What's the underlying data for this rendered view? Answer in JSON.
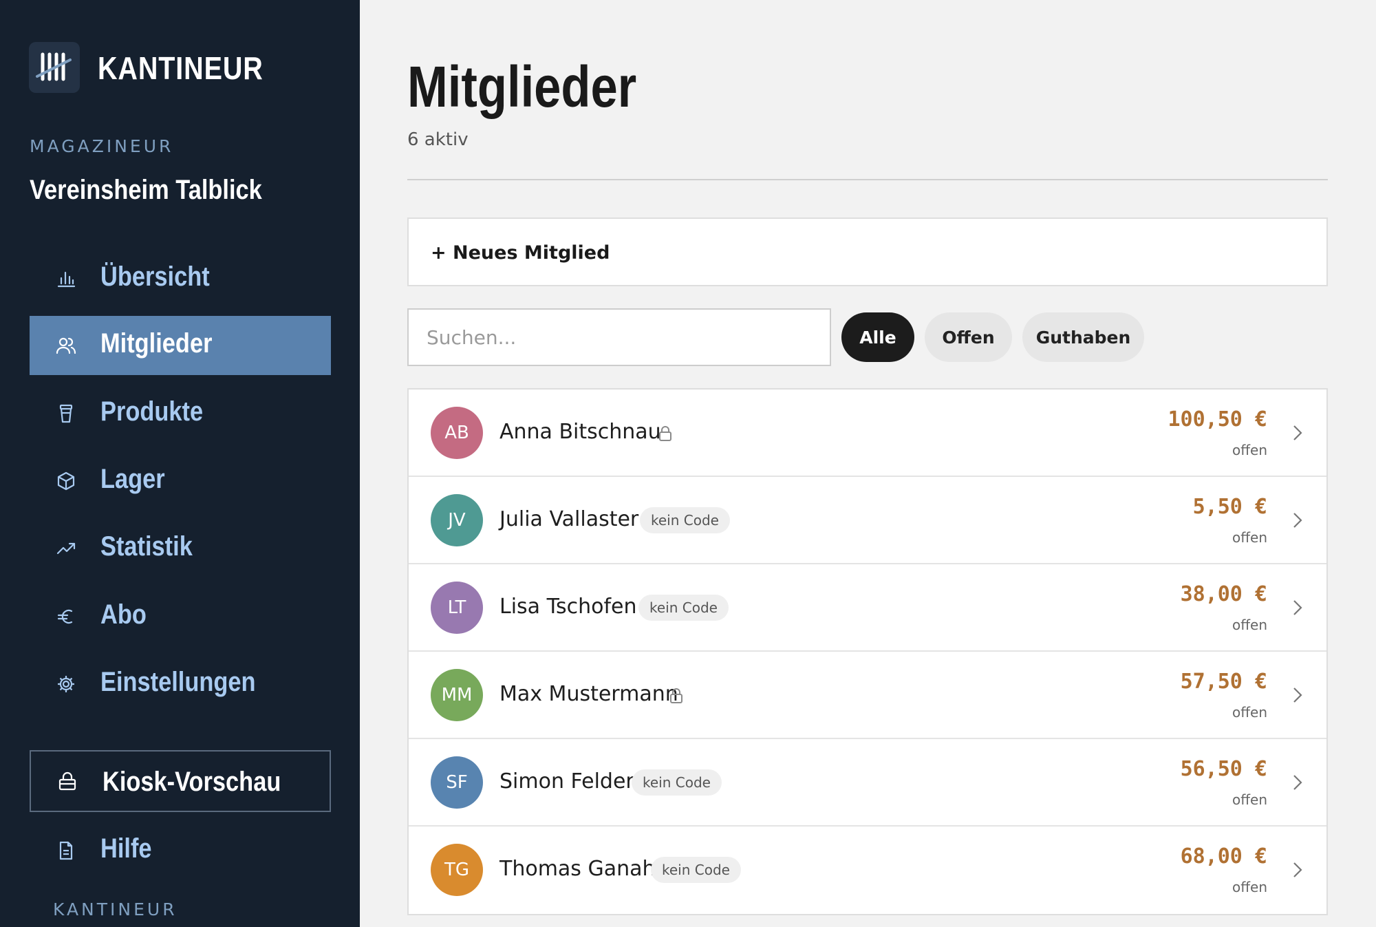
{
  "sidebar": {
    "brand": "KANTINEUR",
    "role_label": "MAGAZINEUR",
    "venue": "Vereinsheim Talblick",
    "nav": [
      {
        "label": "Übersicht",
        "icon": "bar-chart-icon"
      },
      {
        "label": "Mitglieder",
        "icon": "users-icon"
      },
      {
        "label": "Produkte",
        "icon": "cup-icon"
      },
      {
        "label": "Lager",
        "icon": "box-icon"
      },
      {
        "label": "Statistik",
        "icon": "trend-icon"
      },
      {
        "label": "Abo",
        "icon": "euro-icon"
      },
      {
        "label": "Einstellungen",
        "icon": "gear-icon"
      }
    ],
    "kiosk_label": "Kiosk-Vorschau",
    "help_label": "Hilfe",
    "footer_label": "KANTINEUR",
    "active_index": 1
  },
  "main": {
    "title": "Mitglieder",
    "subtitle": "6 aktiv",
    "new_member_label": "+ Neues Mitglied",
    "search_placeholder": "Suchen...",
    "filters": [
      "Alle",
      "Offen",
      "Guthaben"
    ],
    "active_filter": "Alle",
    "members": [
      {
        "initials": "AB",
        "name": "Anna Bitschnau",
        "marker": "lock",
        "badge": "",
        "amount": "100,50 €",
        "status": "offen",
        "color": "#c46b82"
      },
      {
        "initials": "JV",
        "name": "Julia Vallaster",
        "marker": "badge",
        "badge": "kein Code",
        "amount": "5,50 €",
        "status": "offen",
        "color": "#4f9a93"
      },
      {
        "initials": "LT",
        "name": "Lisa Tschofen",
        "marker": "badge",
        "badge": "kein Code",
        "amount": "38,00 €",
        "status": "offen",
        "color": "#9879b0"
      },
      {
        "initials": "MM",
        "name": "Max Mustermann",
        "marker": "lock",
        "badge": "",
        "amount": "57,50 €",
        "status": "offen",
        "color": "#78a95b"
      },
      {
        "initials": "SF",
        "name": "Simon Felder",
        "marker": "badge",
        "badge": "kein Code",
        "amount": "56,50 €",
        "status": "offen",
        "color": "#5884b0"
      },
      {
        "initials": "TG",
        "name": "Thomas Ganahl",
        "marker": "badge",
        "badge": "kein Code",
        "amount": "68,00 €",
        "status": "offen",
        "color": "#d98b2e"
      }
    ]
  },
  "colors": {
    "sidebar_bg": "#15202e",
    "active_nav": "#5a82ae",
    "nav_text": "#a8caf0",
    "amount": "#b07133"
  }
}
